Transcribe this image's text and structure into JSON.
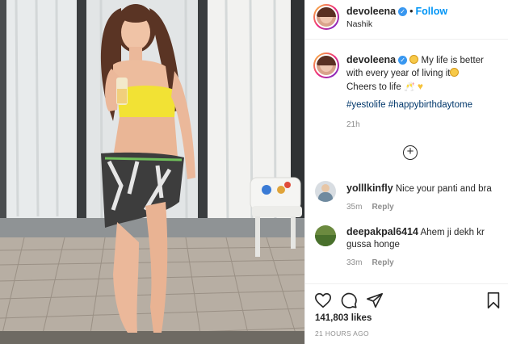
{
  "post": {
    "author": "devoleena",
    "follow_label": "Follow",
    "location": "Nashik",
    "dot": "•",
    "more_icon": "•••"
  },
  "caption": {
    "username": "devoleena",
    "line1": "My life is better with every year of living it",
    "line2": "Cheers to life",
    "hashtags": "#yestolife #happybirthdaytome",
    "time": "21h"
  },
  "load_more_icon": "+",
  "comments": [
    {
      "username": "yolllkinfly",
      "text": "Nice your panti and bra",
      "time": "35m",
      "reply_label": "Reply"
    },
    {
      "username": "deepakpal6414",
      "text": "Ahem ji dekh kr gussa honge",
      "time": "33m",
      "reply_label": "Reply"
    }
  ],
  "actions": {
    "likes": "141,803 likes",
    "age": "21 HOURS AGO",
    "icons": [
      "heart-icon",
      "comment-icon",
      "share-icon",
      "bookmark-icon"
    ]
  },
  "colors": {
    "accent": "#0095f6",
    "verified": "#3897f0",
    "hashtag": "#00376b",
    "muted": "#8e8e8e"
  }
}
